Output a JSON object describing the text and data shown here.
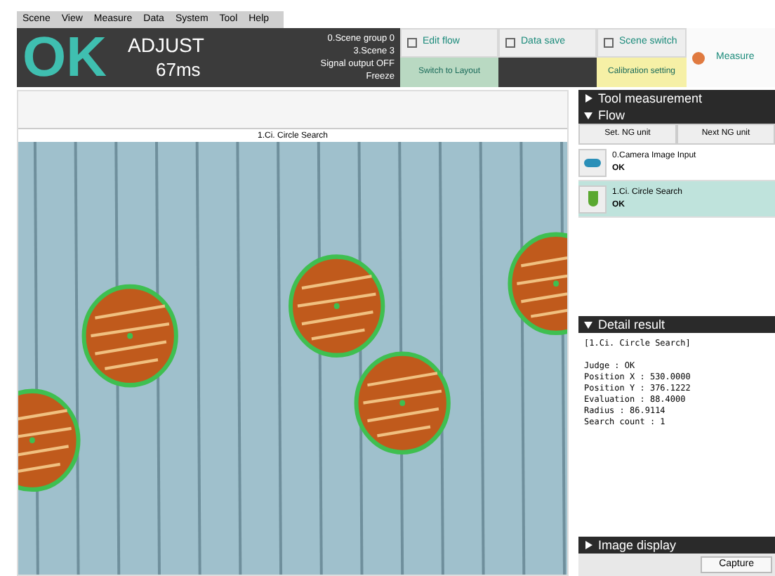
{
  "menu": [
    {
      "label": "Scene"
    },
    {
      "label": "View"
    },
    {
      "label": "Measure"
    },
    {
      "label": "Data"
    },
    {
      "label": "System"
    },
    {
      "label": "Tool"
    },
    {
      "label": "Help"
    }
  ],
  "header": {
    "judge": "OK",
    "mode": "ADJUST",
    "time": "67ms",
    "info": [
      "0.Scene group 0",
      "3.Scene 3",
      "Signal output OFF",
      "Freeze"
    ]
  },
  "toolbar": [
    {
      "label": "Edit flow",
      "kind": "icon"
    },
    {
      "label": "Data save",
      "kind": "icon"
    },
    {
      "label": "Scene switch",
      "kind": "icon"
    },
    {
      "label": "Measure",
      "kind": "measure"
    }
  ],
  "toolbar_row2": [
    {
      "label": "Switch to Layout",
      "kind": "green"
    },
    {
      "label": "Calibration setting",
      "kind": "yellow"
    }
  ],
  "image_title": "1.Ci. Circle Search",
  "panels": [
    {
      "title": "Tool measurement",
      "expanded": false
    },
    {
      "title": "Flow",
      "expanded": true
    }
  ],
  "flow_buttons": [
    "Set. NG unit",
    "Next NG unit"
  ],
  "flow": [
    {
      "name": "0.Camera Image Input",
      "result": "OK",
      "kind": "camera",
      "selected": false
    },
    {
      "name": "1.Ci. Circle Search",
      "result": "OK",
      "kind": "search",
      "selected": true
    }
  ],
  "detail": {
    "title": "Detail result",
    "expanded": true,
    "heading": "[1.Ci. Circle Search]",
    "lines": [
      "Judge : OK",
      "Position X : 530.0000",
      "Position Y : 376.1222",
      "Evaluation : 88.4000",
      "Radius : 86.9114",
      "Search count : 1"
    ]
  },
  "image_display": {
    "title": "Image display",
    "expanded": false
  },
  "capture_button": "Capture"
}
